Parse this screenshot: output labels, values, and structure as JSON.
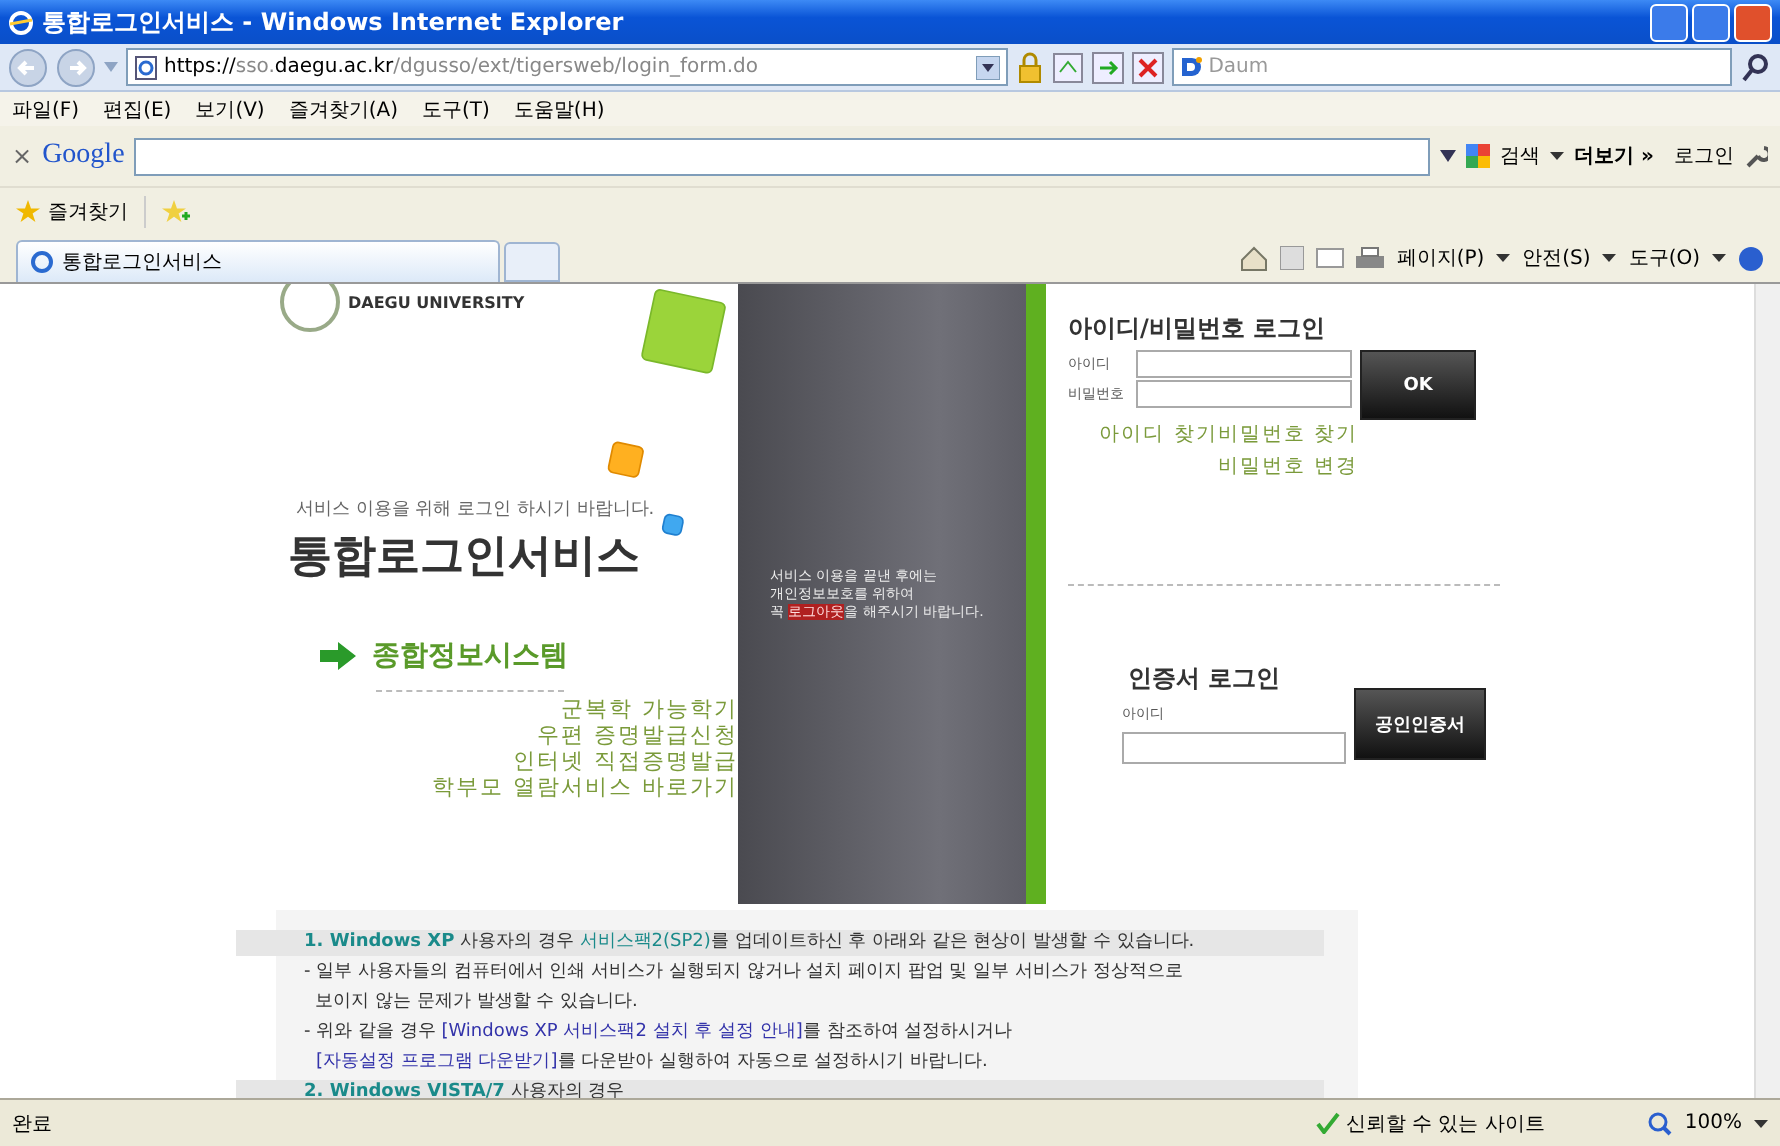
{
  "window": {
    "title": "통합로그인서비스 - Windows Internet Explorer"
  },
  "address_bar": {
    "scheme": "https://",
    "subdomain": "sso.",
    "domain": "daegu.ac.kr",
    "path": "/dgusso/ext/tigersweb/login_form.do",
    "search_placeholder": "Daum"
  },
  "menu_bar": [
    "파일(F)",
    "편집(E)",
    "보기(V)",
    "즐겨찾기(A)",
    "도구(T)",
    "도움말(H)"
  ],
  "google_bar": {
    "close": "×",
    "logo": "Google",
    "search": "검색",
    "more": "더보기 »",
    "login": "로그인"
  },
  "favorites_bar": {
    "label": "즐겨찾기"
  },
  "tabs": [
    {
      "label": "통합로그인서비스",
      "selected": true
    }
  ],
  "command_bar": [
    "페이지(P)",
    "안전(S)",
    "도구(O)"
  ],
  "page": {
    "logo_text": "DAEGU UNIVERSITY",
    "subtitle": "서비스 이용을 위해 로그인 하시기 바랍니다.",
    "title": "통합로그인서비스",
    "system_link": "종합정보시스템",
    "links": [
      "군복학 가능학기",
      "우편 증명발급신청",
      "인터넷 직접증명발급",
      "학부모 열람서비스 바로가기"
    ],
    "notice": {
      "lines": [
        "서비스 이용을 끝낸 후에는",
        "개인정보보호를 위하여"
      ],
      "prefix": "꼭 ",
      "highlight": "로그아웃",
      "suffix": "을 해주시기 바랍니다."
    },
    "login": {
      "heading": "아이디/비밀번호 로그인",
      "id_label": "아이디",
      "pw_label": "비밀번호",
      "ok": "OK",
      "find_id": "아이디 찾기",
      "find_pw": "비밀번호 찾기",
      "change_pw": "비밀번호 변경"
    },
    "cert_login": {
      "heading": "인증서 로그인",
      "id_label": "아이디",
      "button": "공인인증서"
    },
    "info": [
      {
        "kind": "heading",
        "parts": [
          {
            "kind": "num",
            "text": "1. Windows XP"
          },
          {
            "kind": "text",
            "text": " 사용자의 경우 "
          },
          {
            "kind": "em",
            "text": "서비스팩2(SP2)"
          },
          {
            "kind": "text",
            "text": "를 업데이트하신 후 아래와 같은 현상이 발생할 수 있습니다."
          }
        ]
      },
      {
        "kind": "body",
        "parts": [
          {
            "kind": "text",
            "text": "- 일부 사용자들의 컴퓨터에서 인쇄 서비스가 실행되지 않거나 설치 페이지 팝업 및 일부 서비스가 정상적으로"
          }
        ]
      },
      {
        "kind": "body",
        "parts": [
          {
            "kind": "text",
            "text": "  보이지 않는 문제가 발생할 수 있습니다."
          }
        ]
      },
      {
        "kind": "body",
        "parts": [
          {
            "kind": "text",
            "text": "- 위와 같을 경우 "
          },
          {
            "kind": "link",
            "text": "[Windows XP 서비스팩2 설치 후 설정 안내]"
          },
          {
            "kind": "text",
            "text": "를 참조하여 설정하시거나"
          }
        ]
      },
      {
        "kind": "indent",
        "parts": [
          {
            "kind": "link",
            "text": "[자동설정 프로그램 다운받기]"
          },
          {
            "kind": "text",
            "text": "를 다운받아 실행하여 자동으로 설정하시기 바랍니다."
          }
        ]
      },
      {
        "kind": "heading",
        "parts": [
          {
            "kind": "num",
            "text": "2. Windows VISTA/7"
          },
          {
            "kind": "text",
            "text": " 사용자의 경우"
          }
        ]
      }
    ]
  },
  "status_bar": {
    "text": "완료",
    "zone": "신뢰할 수 있는 사이트",
    "zoom": "100%"
  }
}
